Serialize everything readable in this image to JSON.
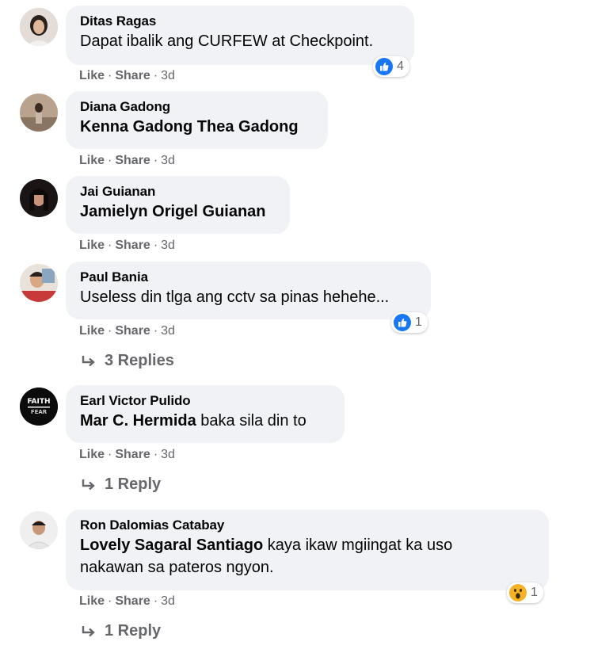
{
  "comments": [
    {
      "author": "Ditas Ragas",
      "text": "Dapat ibalik ang CURFEW at Checkpoint.",
      "like": "Like",
      "share": "Share",
      "dot": "·",
      "time": "3d",
      "reaction": {
        "icon": "like-icon",
        "count": "4"
      }
    },
    {
      "author": "Diana Gadong",
      "text": "Kenna Gadong Thea Gadong",
      "like": "Like",
      "share": "Share",
      "dot": "·",
      "time": "3d"
    },
    {
      "author": "Jai Guianan",
      "text": "Jamielyn Origel Guianan",
      "like": "Like",
      "share": "Share",
      "dot": "·",
      "time": "3d"
    },
    {
      "author": "Paul Bania",
      "text": "Useless din tlga ang cctv sa pinas hehehe...",
      "like": "Like",
      "share": "Share",
      "dot": "·",
      "time": "3d",
      "reaction": {
        "icon": "like-icon",
        "count": "1"
      },
      "replies": "3 Replies"
    },
    {
      "author": "Earl Victor Pulido",
      "mention": "Mar C. Hermida",
      "text": " baka sila din to",
      "like": "Like",
      "share": "Share",
      "dot": "·",
      "time": "3d",
      "replies": "1 Reply",
      "avatar_text": [
        "FAITH",
        "FEAR"
      ]
    },
    {
      "author": "Ron Dalomias Catabay",
      "mention": "Lovely Sagaral Santiago",
      "text": " kaya ikaw mgiingat ka uso",
      "text_line2": "nakawan sa pateros ngyon.",
      "like": "Like",
      "share": "Share",
      "dot": "·",
      "time": "3d",
      "reaction": {
        "icon": "wow-icon",
        "count": "1"
      },
      "replies": "1 Reply"
    }
  ],
  "colors": {
    "bubble": "#f0f2f5",
    "secondary_text": "#65676b",
    "like_blue": "#1877f2",
    "wow_yellow": "#f7b125"
  }
}
